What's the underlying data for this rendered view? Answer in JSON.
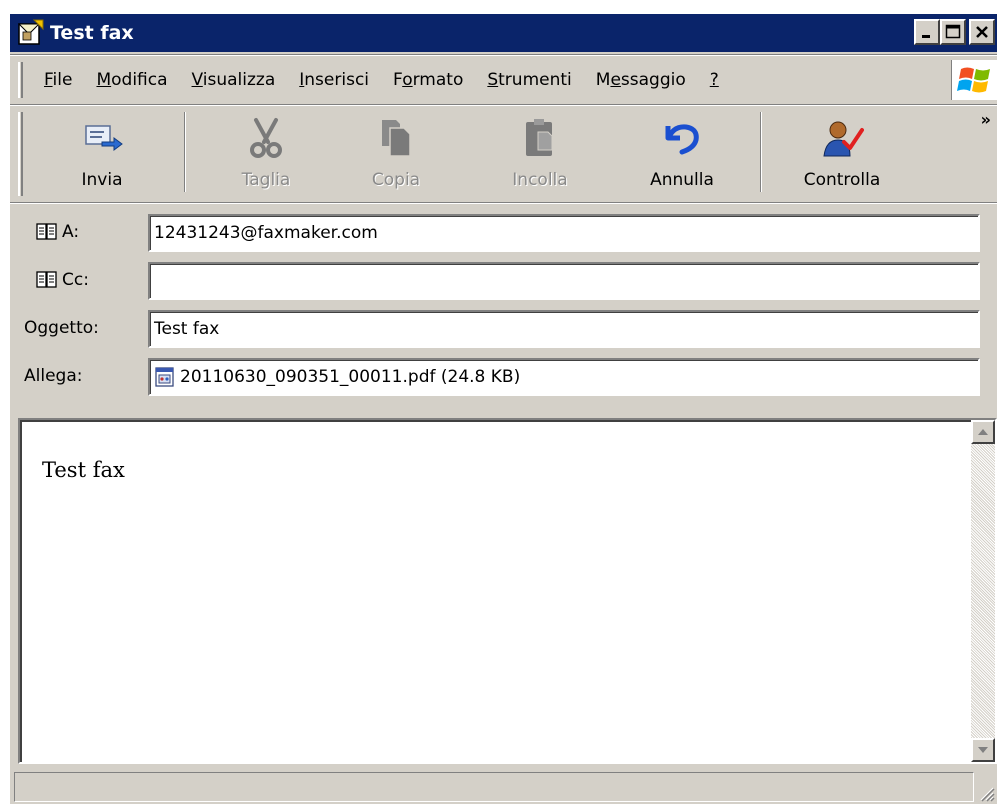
{
  "window": {
    "title": "Test fax",
    "title_buttons": {
      "minimize": "_",
      "maximize": "□",
      "close": "×"
    }
  },
  "menu": {
    "items": [
      {
        "label": "File",
        "ul": "F",
        "rest": "ile"
      },
      {
        "label": "Modifica",
        "ul": "M",
        "rest": "odifica"
      },
      {
        "label": "Visualizza",
        "ul": "V",
        "rest": "isualizza"
      },
      {
        "label": "Inserisci",
        "ul": "I",
        "rest": "nserisci"
      },
      {
        "label": "Formato",
        "pre": "F",
        "ul": "o",
        "rest": "rmato"
      },
      {
        "label": "Strumenti",
        "ul": "S",
        "rest": "trumenti"
      },
      {
        "label": "Messaggio",
        "pre": "M",
        "ul": "e",
        "rest": "ssaggio"
      },
      {
        "label": "?",
        "ul": "?",
        "rest": ""
      }
    ]
  },
  "toolbar": {
    "send_label": "Invia",
    "cut_label": "Taglia",
    "copy_label": "Copia",
    "paste_label": "Incolla",
    "undo_label": "Annulla",
    "check_label": "Controlla",
    "overflow": "»"
  },
  "fields": {
    "to_label": "A:",
    "to_value": "12431243@faxmaker.com",
    "cc_label": "Cc:",
    "cc_value": "",
    "subject_label": "Oggetto:",
    "subject_value": "Test fax",
    "attach_label": "Allega:",
    "attach_value": "20110630_090351_00011.pdf (24.8 KB)"
  },
  "body": {
    "text": "Test fax"
  },
  "colors": {
    "titlebar": "#0a246a",
    "chrome": "#d4d0c8"
  }
}
